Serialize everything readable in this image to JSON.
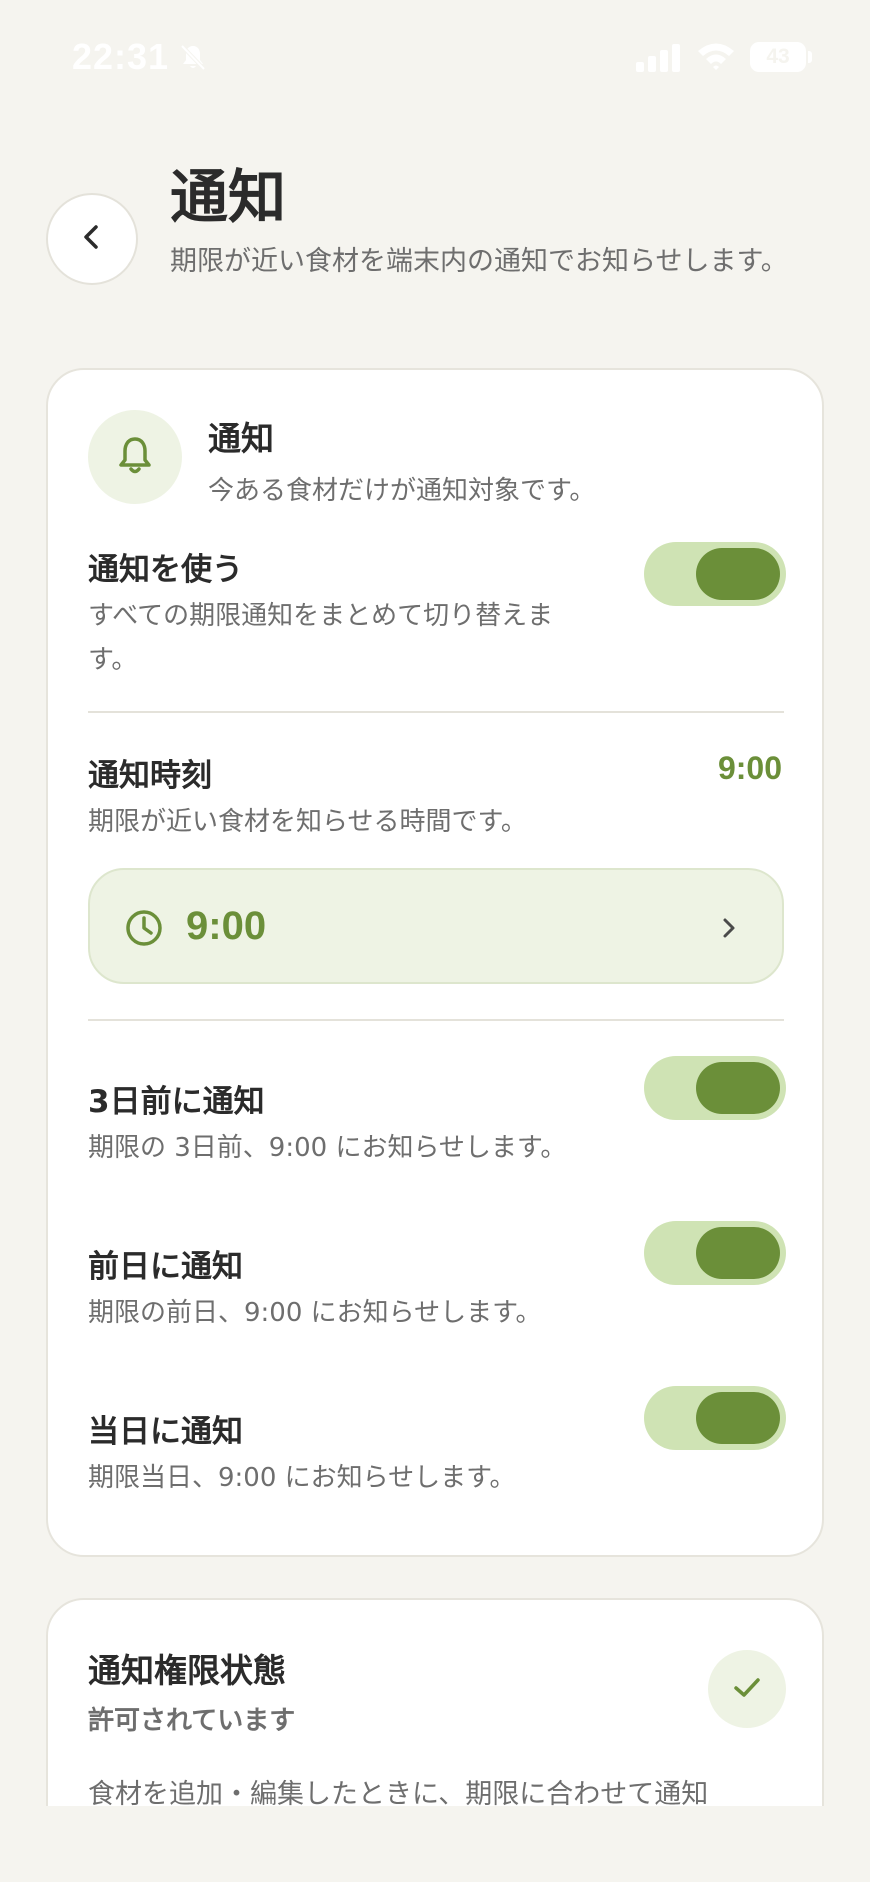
{
  "status_bar": {
    "time": "22:31",
    "battery": "43"
  },
  "header": {
    "title": "通知",
    "subtitle": "期限が近い食材を端末内の通知でお知らせします。"
  },
  "notifications": {
    "section": {
      "title": "通知",
      "description": "今ある食材だけが通知対象です。"
    },
    "use": {
      "title": "通知を使う",
      "description": "すべての期限通知をまとめて切り替えます。",
      "enabled": true
    },
    "time": {
      "title": "通知時刻",
      "description": "期限が近い食材を知らせる時間です。",
      "value": "9:00",
      "picker_value": "9:00"
    },
    "three_days": {
      "title": "3日前に通知",
      "description": "期限の 3日前、9:00 にお知らせします。",
      "enabled": true
    },
    "day_before": {
      "title": "前日に通知",
      "description": "期限の前日、9:00 にお知らせします。",
      "enabled": true
    },
    "same_day": {
      "title": "当日に通知",
      "description": "期限当日、9:00 にお知らせします。",
      "enabled": true
    }
  },
  "permission": {
    "title": "通知権限状態",
    "status": "許可されています",
    "description": "食材を追加・編集したときに、期限に合わせて通知"
  },
  "colors": {
    "accent": "#6b8f39",
    "accent_light": "#cfe3b4",
    "tint": "#eef3e4",
    "background": "#f5f4ef"
  },
  "icons": [
    "bell-slash-icon",
    "signal-icon",
    "wifi-icon",
    "chevron-left-icon",
    "bell-icon",
    "clock-icon",
    "chevron-right-icon",
    "check-icon"
  ]
}
